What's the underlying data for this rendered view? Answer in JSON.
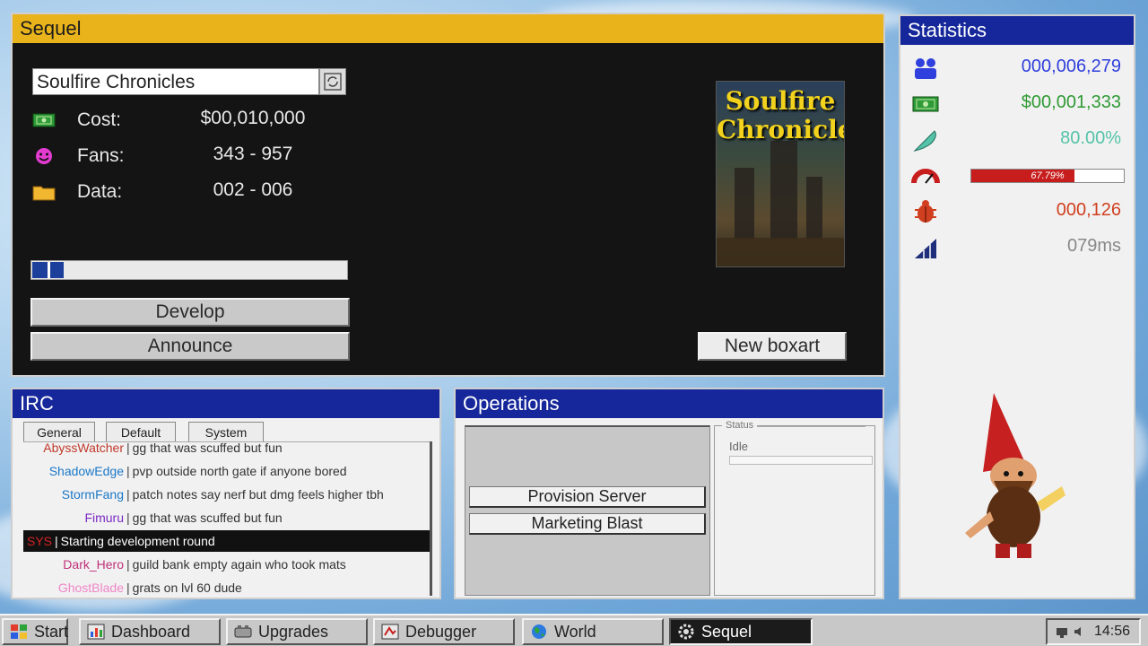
{
  "sequel": {
    "title": "Sequel",
    "game_name": "Soulfire Chronicles",
    "cost_label": "Cost:",
    "cost_value": "$00,010,000",
    "fans_label": "Fans:",
    "fans_value": "343 - 957",
    "data_label": "Data:",
    "data_value": "002 - 006",
    "progress_fraction": 0.1,
    "develop_label": "Develop",
    "announce_label": "Announce",
    "new_boxart_label": "New boxart",
    "boxart_title_line1": "Soulfire",
    "boxart_title_line2": "Chronicles",
    "icons": {
      "cost": "money-icon",
      "fans": "smiley-icon",
      "data": "folder-icon",
      "refresh": "refresh-icon"
    }
  },
  "statistics": {
    "title": "Statistics",
    "players": "000,006,279",
    "money": "$00,001,333",
    "approval": "80.00%",
    "heat_label": "67.79%",
    "heat_fraction": 0.6779,
    "bugs": "000,126",
    "ping": "079ms",
    "colors": {
      "players": "#2f3fdd",
      "money": "#2f9a34",
      "approval": "#55c3a8",
      "bugs": "#d04020",
      "ping": "#888888"
    }
  },
  "irc": {
    "title": "IRC",
    "tabs": [
      "General",
      "Default",
      "System"
    ],
    "messages": [
      {
        "nick": "AbyssWatcher",
        "text": "gg that was scuffed but fun",
        "color": "#c0392b"
      },
      {
        "nick": "ShadowEdge",
        "text": "pvp outside north gate if anyone bored",
        "color": "#1c78c8"
      },
      {
        "nick": "StormFang",
        "text": "patch notes say nerf but dmg feels higher tbh",
        "color": "#1c78c8"
      },
      {
        "nick": "Fimuru",
        "text": "gg that was scuffed but fun",
        "color": "#7a2bc2"
      },
      {
        "nick": "SYS",
        "text": "Starting development round",
        "color": "#d52222",
        "system": true
      },
      {
        "nick": "Dark_Hero",
        "text": "guild bank empty again who took mats",
        "color": "#c0307a"
      },
      {
        "nick": "GhostBlade",
        "text": "grats on lvl 60 dude",
        "color": "#ef86c8"
      }
    ]
  },
  "operations": {
    "title": "Operations",
    "provision_label": "Provision Server",
    "marketing_label": "Marketing Blast",
    "status_legend": "Status",
    "status_text": "Idle"
  },
  "taskbar": {
    "start": "Start",
    "dashboard": "Dashboard",
    "upgrades": "Upgrades",
    "debugger": "Debugger",
    "world": "World",
    "sequel": "Sequel",
    "clock": "14:56"
  }
}
